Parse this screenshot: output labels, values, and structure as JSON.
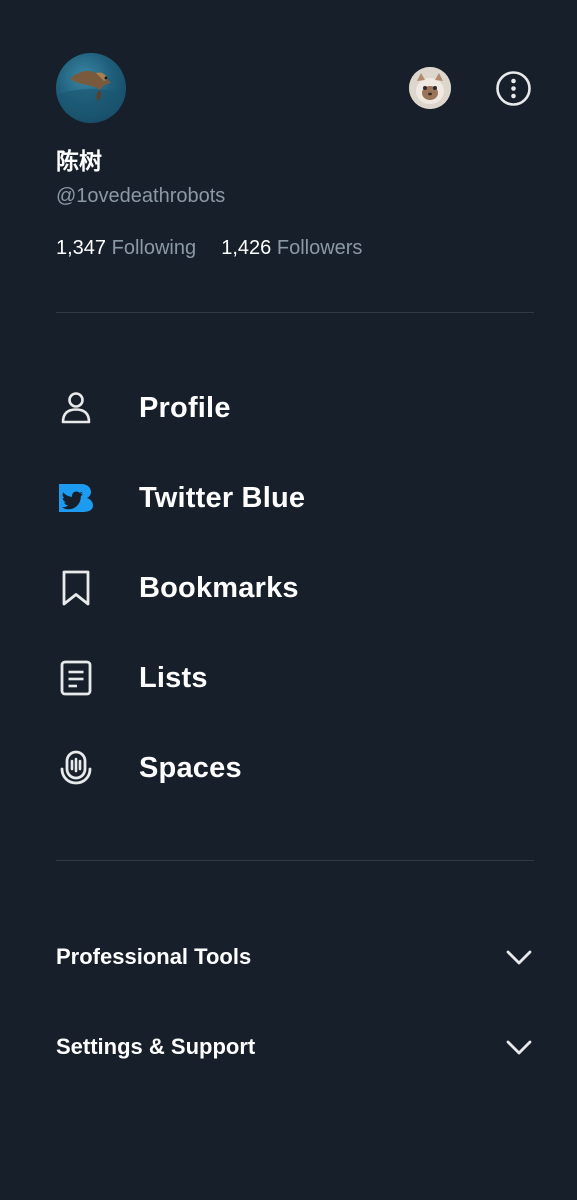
{
  "profile": {
    "display_name": "陈树",
    "handle": "@1ovedeathrobots",
    "following_count": "1,347",
    "following_label": "Following",
    "followers_count": "1,426",
    "followers_label": "Followers"
  },
  "menu": [
    {
      "label": "Profile",
      "icon": "person-icon"
    },
    {
      "label": "Twitter Blue",
      "icon": "twitter-blue-icon"
    },
    {
      "label": "Bookmarks",
      "icon": "bookmark-icon"
    },
    {
      "label": "Lists",
      "icon": "list-icon"
    },
    {
      "label": "Spaces",
      "icon": "spaces-icon"
    }
  ],
  "sections": [
    {
      "label": "Professional Tools"
    },
    {
      "label": "Settings & Support"
    }
  ],
  "colors": {
    "background": "#17202a",
    "text_primary": "#ffffff",
    "text_secondary": "#8b98a5",
    "divider": "#2f3a45",
    "twitter_blue": "#1d9bf0"
  }
}
